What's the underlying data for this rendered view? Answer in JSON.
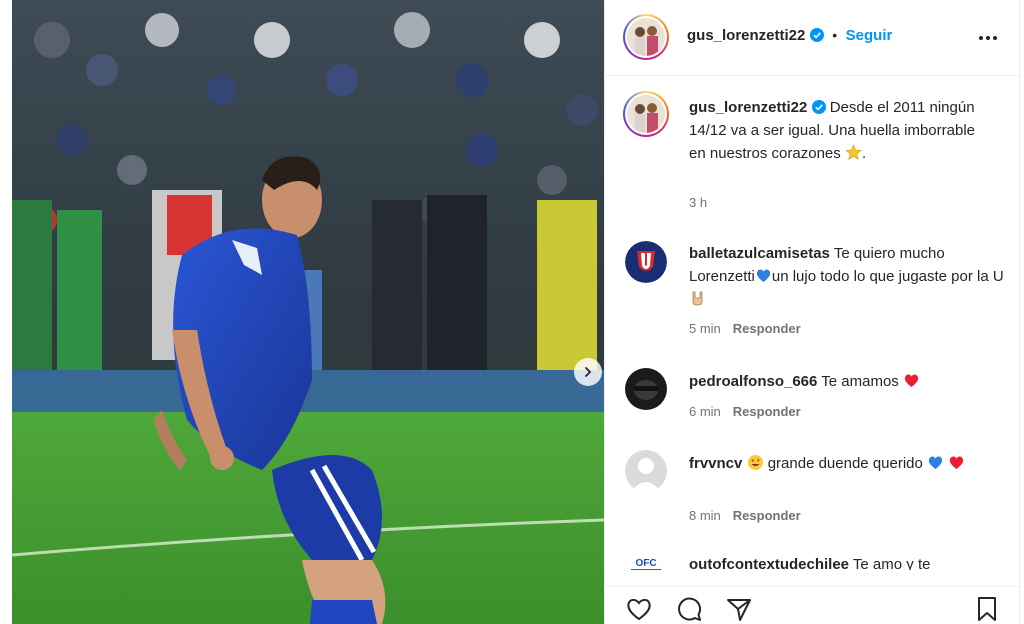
{
  "post": {
    "author": "gus_lorenzetti22",
    "follow_label": "Seguir",
    "separator": "•",
    "caption_text": "Desde el 2011 ningún 14/12 va a ser igual. Una huella imborrable en nuestros corazones",
    "caption_time": "3 h"
  },
  "comments": [
    {
      "username": "balletazulcamisetas",
      "text_a": "Te quiero mucho Lorenzetti",
      "text_b": "un lujo todo lo que jugaste por la U",
      "time": "5 min",
      "reply_label": "Responder"
    },
    {
      "username": "pedroalfonso_666",
      "text_a": "Te amamos",
      "time": "6 min",
      "reply_label": "Responder"
    },
    {
      "username": "frvvncv",
      "text_a": "grande duende querido",
      "time": "8 min",
      "reply_label": "Responder"
    },
    {
      "username": "outofcontextudechilee",
      "text_a": "Te amo y te",
      "logo_text": "OFC"
    }
  ],
  "icons": {
    "like": "heart-icon",
    "comment": "comment-icon",
    "share": "share-icon",
    "save": "bookmark-icon",
    "more": "more-options-icon",
    "next": "chevron-right-icon"
  },
  "colors": {
    "accent": "#0095f6",
    "verified": "#0095f6",
    "text": "#262626",
    "muted": "#737373",
    "team_blue": "#1d3fae",
    "heart_red": "#ed1c2e"
  }
}
